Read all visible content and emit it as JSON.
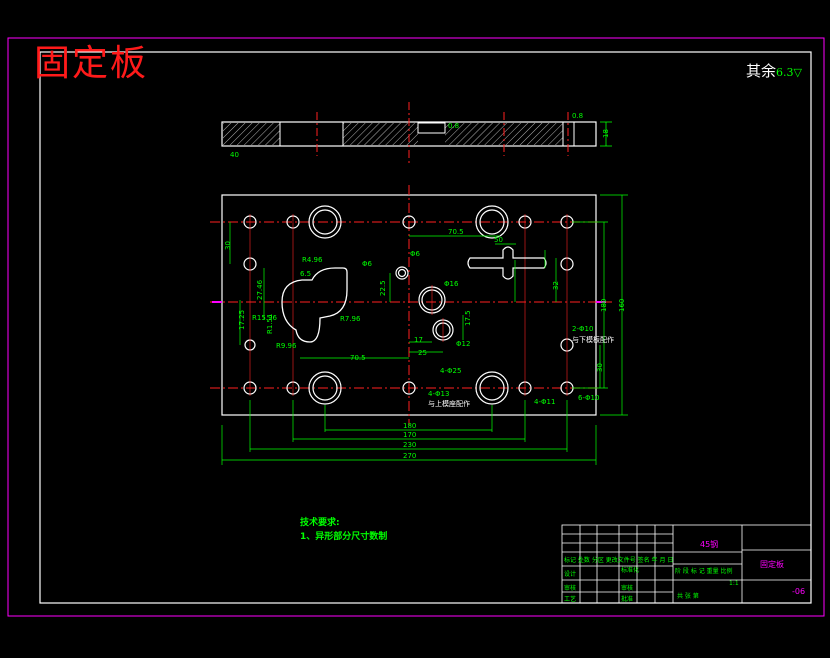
{
  "title": "固定板",
  "surface_finish": {
    "label": "其余",
    "symbol": "6.3"
  },
  "tech_requirements": {
    "heading": "技术要求:",
    "line1": "1、异形部分尺寸数制"
  },
  "dims": {
    "d_top_18": "18",
    "d_top_08": "0.8",
    "d_top_40": "40",
    "d_top_side": "0.8",
    "r496": "R4.96",
    "r1596": "R15.96",
    "r796": "R7.96",
    "r996": "R9.96",
    "d2746": "27.46",
    "d65": "6.5",
    "d1725": "17.25",
    "d_left_30": "30",
    "d_left_b": "R1.51",
    "d705a": "70.5",
    "d705b": "70.5",
    "phi6a": "Φ6",
    "phi6b": "Φ6",
    "phi16": "Φ16",
    "phi12": "Φ12",
    "d17a": "17.5",
    "d17b": "17",
    "d25": "25",
    "d32": "32",
    "d50": "50",
    "d225": "22.5",
    "note_4d25": "4-Φ25",
    "note_4d13": "4-Φ13",
    "note_4d11": "4-Φ11",
    "note_2d10": "2-Φ10",
    "note_6d10": "6-Φ10",
    "note_lower": "与上模座配作",
    "note_right": "与下模板配作",
    "w180": "180",
    "w170": "170",
    "w230": "230",
    "w270": "270",
    "h180": "180",
    "h160": "160",
    "h30": "30"
  },
  "title_block": {
    "material": "45钢",
    "part_name": "固定板",
    "drawing_no": "-06",
    "rev_header": "标记 处数 分区 更改文件号 签名 年 月 日",
    "design": "设计",
    "check": "审核",
    "process": "工艺",
    "standard": "标准化",
    "review": "审核",
    "approve": "批准",
    "stage_row": "阶 段 标 记   重量   比例",
    "scale": "1:1",
    "sheet_row": "共    张    第"
  }
}
